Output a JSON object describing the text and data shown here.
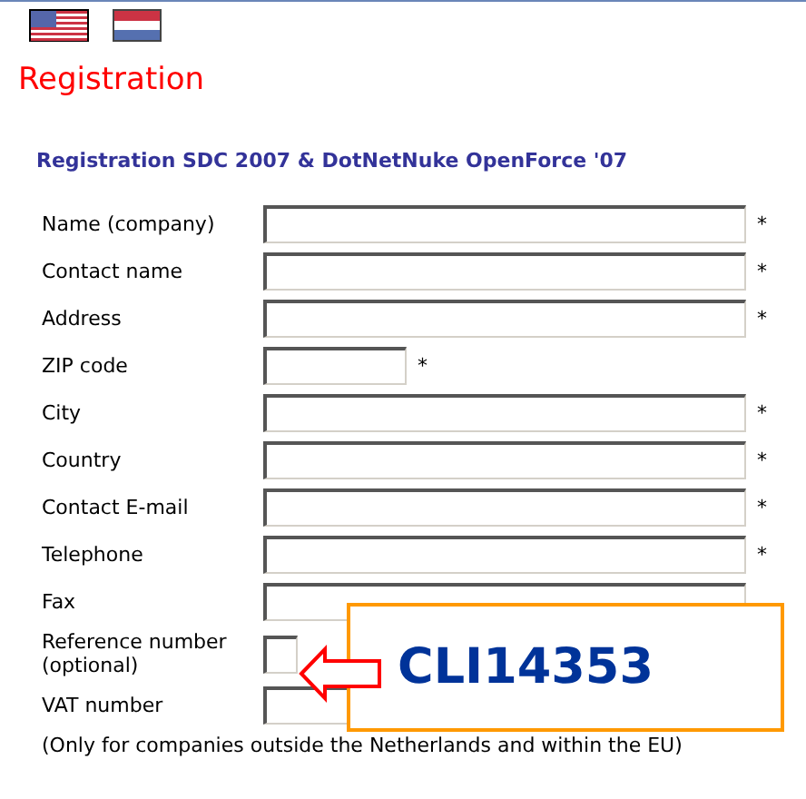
{
  "languages": [
    {
      "kind": "us"
    },
    {
      "kind": "nl"
    }
  ],
  "title": "Registration",
  "heading": "Registration SDC 2007 & DotNetNuke OpenForce '07",
  "fields": [
    {
      "label": "Name (company)",
      "kind": "wide",
      "mark": "*"
    },
    {
      "label": "Contact name",
      "kind": "wide",
      "mark": "*"
    },
    {
      "label": "Address",
      "kind": "wide",
      "mark": "*"
    },
    {
      "label": "ZIP code",
      "kind": "short",
      "mark": "*"
    },
    {
      "label": "City",
      "kind": "wide",
      "mark": "*"
    },
    {
      "label": "Country",
      "kind": "wide",
      "mark": "*"
    },
    {
      "label": "Contact E-mail",
      "kind": "wide",
      "mark": "*"
    },
    {
      "label": "Telephone",
      "kind": "wide",
      "mark": "*"
    },
    {
      "label": "Fax",
      "kind": "wide"
    },
    {
      "label": "Reference number (optional)",
      "kind": "covered"
    },
    {
      "label": "VAT number",
      "kind": "medium"
    }
  ],
  "note": "(Only for companies outside the Netherlands and within the EU)",
  "callout": {
    "text": "CLI14353"
  }
}
